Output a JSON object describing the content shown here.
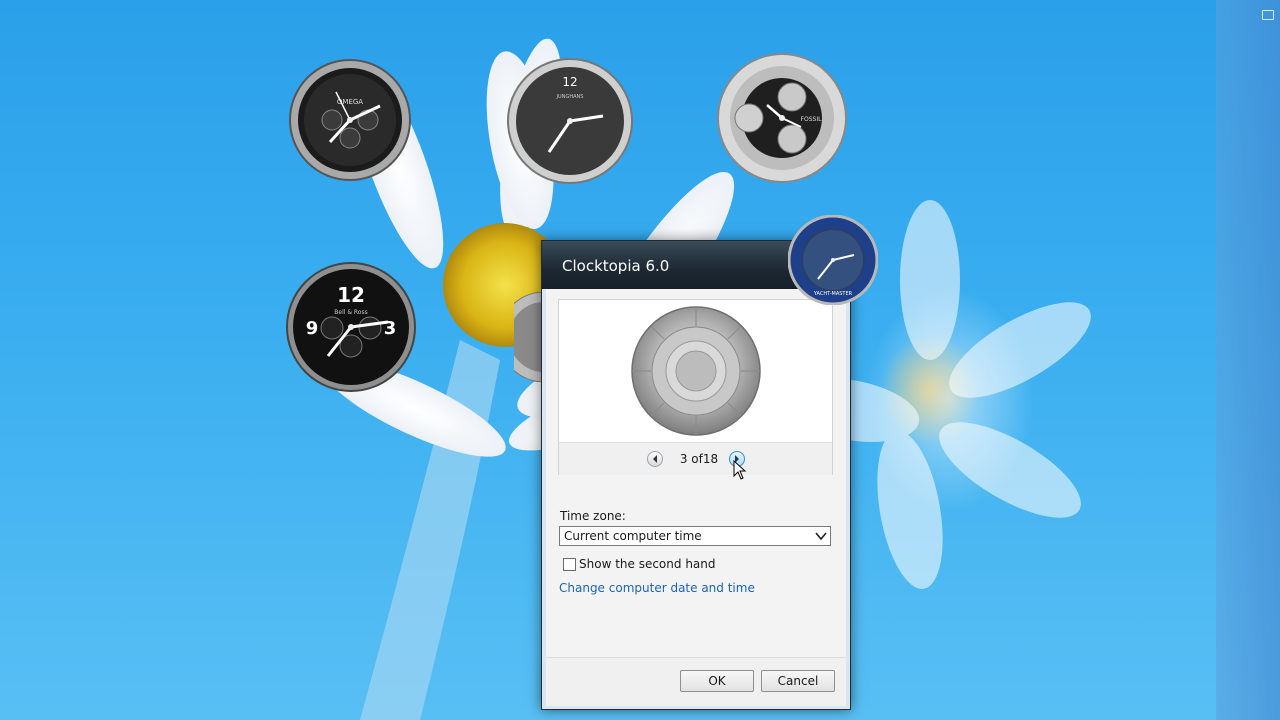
{
  "dialog": {
    "title": "Clocktopia 6.0",
    "pager_text": "3 of18",
    "timezone_label": "Time zone:",
    "timezone_value": "Current computer time",
    "second_hand_label": "Show the second hand",
    "second_hand_checked": false,
    "change_link": "Change computer date and time",
    "ok_label": "OK",
    "cancel_label": "Cancel"
  },
  "desktop_clocks": [
    {
      "name": "omega-clock",
      "label": "OMEGA"
    },
    {
      "name": "junghans-clock",
      "label": "JUNGHANS"
    },
    {
      "name": "fossil-clock",
      "label": "FOSSIL"
    },
    {
      "name": "bell-ross-clock",
      "label": "Bell & Ross"
    },
    {
      "name": "rolex-yachtmaster-clock",
      "label": "YACHT-MASTER"
    }
  ],
  "colors": {
    "desktop_blue": "#3aaef0",
    "titlebar_dark": "#1d2833",
    "link_blue": "#1c64b4"
  }
}
